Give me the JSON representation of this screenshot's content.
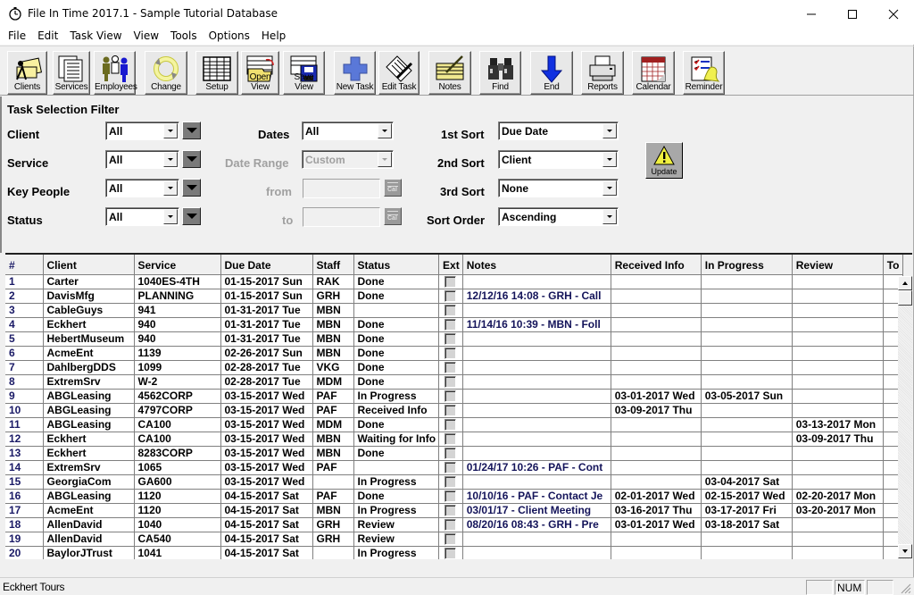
{
  "window": {
    "title": "File In Time 2017.1 - Sample Tutorial Database",
    "controls": {
      "minimize": "minimize",
      "maximize": "maximize",
      "close": "close"
    }
  },
  "menu": [
    "File",
    "Edit",
    "Task View",
    "View",
    "Tools",
    "Options",
    "Help"
  ],
  "toolbar": {
    "buttons": [
      {
        "id": "clients",
        "label": "Clients",
        "icon": "clients-icon"
      },
      {
        "id": "services",
        "label": "Services",
        "icon": "services-icon"
      },
      {
        "id": "employees",
        "label": "Employees",
        "icon": "employees-icon"
      },
      {
        "id": "change",
        "label": "Change",
        "icon": "change-icon"
      },
      {
        "id": "setup",
        "label": "Setup",
        "icon": "setup-icon"
      },
      {
        "id": "open-view",
        "label": "Open View",
        "icon": "open-view-icon"
      },
      {
        "id": "save-view",
        "label": "Save View",
        "icon": "save-view-icon"
      },
      {
        "id": "new-task",
        "label": "New Task",
        "icon": "plus-icon"
      },
      {
        "id": "edit-task",
        "label": "Edit Task",
        "icon": "edit-icon"
      },
      {
        "id": "notes",
        "label": "Notes",
        "icon": "notes-icon"
      },
      {
        "id": "find",
        "label": "Find",
        "icon": "binoculars-icon"
      },
      {
        "id": "end",
        "label": "End",
        "icon": "arrow-down-icon"
      },
      {
        "id": "reports",
        "label": "Reports",
        "icon": "printer-icon"
      },
      {
        "id": "calendar",
        "label": "Calendar",
        "icon": "calendar-icon"
      },
      {
        "id": "reminder",
        "label": "Reminder",
        "icon": "bell-icon"
      }
    ]
  },
  "filter": {
    "title": "Task Selection Filter",
    "client": {
      "label": "Client",
      "value": "All"
    },
    "service": {
      "label": "Service",
      "value": "All"
    },
    "key_people": {
      "label": "Key People",
      "value": "All"
    },
    "status": {
      "label": "Status",
      "value": "All"
    },
    "dates": {
      "label": "Dates",
      "value": "All"
    },
    "date_range": {
      "label": "Date Range",
      "value": "Custom"
    },
    "from": {
      "label": "from",
      "value": ""
    },
    "to": {
      "label": "to",
      "value": ""
    },
    "cal_label": "Cal",
    "sort1": {
      "label": "1st Sort",
      "value": "Due Date"
    },
    "sort2": {
      "label": "2nd Sort",
      "value": "Client"
    },
    "sort3": {
      "label": "3rd Sort",
      "value": "None"
    },
    "sort_order": {
      "label": "Sort Order",
      "value": "Ascending"
    },
    "update_label": "Update"
  },
  "grid": {
    "columns": [
      "#",
      "Client",
      "Service",
      "Due Date",
      "Staff",
      "Status",
      "Ext",
      "Notes",
      "Received Info",
      "In Progress",
      "Review",
      "To"
    ],
    "rows": [
      [
        "1",
        "Carter",
        "1040ES-4TH",
        "01-15-2017 Sun",
        "RAK",
        "Done",
        "",
        "",
        "",
        "",
        ""
      ],
      [
        "2",
        "DavisMfg",
        "PLANNING",
        "01-15-2017 Sun",
        "GRH",
        "Done",
        "",
        "12/12/16 14:08 - GRH - Call",
        "",
        "",
        ""
      ],
      [
        "3",
        "CableGuys",
        "941",
        "01-31-2017 Tue",
        "MBN",
        "",
        "",
        "",
        "",
        "",
        ""
      ],
      [
        "4",
        "Eckhert",
        "940",
        "01-31-2017 Tue",
        "MBN",
        "Done",
        "",
        "11/14/16 10:39 - MBN - Foll",
        "",
        "",
        ""
      ],
      [
        "5",
        "HebertMuseum",
        "940",
        "01-31-2017 Tue",
        "MBN",
        "Done",
        "",
        "",
        "",
        "",
        ""
      ],
      [
        "6",
        "AcmeEnt",
        "1139",
        "02-26-2017 Sun",
        "MBN",
        "Done",
        "",
        "",
        "",
        "",
        ""
      ],
      [
        "7",
        "DahlbergDDS",
        "1099",
        "02-28-2017 Tue",
        "VKG",
        "Done",
        "",
        "",
        "",
        "",
        ""
      ],
      [
        "8",
        "ExtremSrv",
        "W-2",
        "02-28-2017 Tue",
        "MDM",
        "Done",
        "",
        "",
        "",
        "",
        ""
      ],
      [
        "9",
        "ABGLeasing",
        "4562CORP",
        "03-15-2017 Wed",
        "PAF",
        "In Progress",
        "",
        "",
        "03-01-2017 Wed",
        "03-05-2017 Sun",
        ""
      ],
      [
        "10",
        "ABGLeasing",
        "4797CORP",
        "03-15-2017 Wed",
        "PAF",
        "Received Info",
        "",
        "",
        "03-09-2017 Thu",
        "",
        ""
      ],
      [
        "11",
        "ABGLeasing",
        "CA100",
        "03-15-2017 Wed",
        "MDM",
        "Done",
        "",
        "",
        "",
        "",
        "03-13-2017 Mon"
      ],
      [
        "12",
        "Eckhert",
        "CA100",
        "03-15-2017 Wed",
        "MBN",
        "Waiting for Info",
        "",
        "",
        "",
        "",
        "03-09-2017 Thu"
      ],
      [
        "13",
        "Eckhert",
        "8283CORP",
        "03-15-2017 Wed",
        "MBN",
        "Done",
        "",
        "",
        "",
        "",
        ""
      ],
      [
        "14",
        "ExtremSrv",
        "1065",
        "03-15-2017 Wed",
        "PAF",
        "",
        "",
        "01/24/17 10:26 - PAF - Cont",
        "",
        "",
        ""
      ],
      [
        "15",
        "GeorgiaCom",
        "GA600",
        "03-15-2017 Wed",
        "",
        "In Progress",
        "",
        "",
        "",
        "03-04-2017 Sat",
        ""
      ],
      [
        "16",
        "ABGLeasing",
        "1120",
        "04-15-2017 Sat",
        "PAF",
        "Done",
        "",
        "10/10/16 - PAF - Contact Je",
        "02-01-2017 Wed",
        "02-15-2017 Wed",
        "02-20-2017 Mon"
      ],
      [
        "17",
        "AcmeEnt",
        "1120",
        "04-15-2017 Sat",
        "MBN",
        "In Progress",
        "",
        "03/01/17 - Client Meeting",
        "03-16-2017 Thu",
        "03-17-2017 Fri",
        "03-20-2017 Mon"
      ],
      [
        "18",
        "AllenDavid",
        "1040",
        "04-15-2017 Sat",
        "GRH",
        "Review",
        "",
        "08/20/16 08:43 - GRH - Pre",
        "03-01-2017 Wed",
        "03-18-2017 Sat",
        ""
      ],
      [
        "19",
        "AllenDavid",
        "CA540",
        "04-15-2017 Sat",
        "GRH",
        "Review",
        "",
        "",
        "",
        "",
        ""
      ],
      [
        "20",
        "BaylorJTrust",
        "1041",
        "04-15-2017 Sat",
        "",
        "In Progress",
        "",
        "",
        "",
        "",
        ""
      ]
    ]
  },
  "statusbar": {
    "text": "Eckhert Tours",
    "num": "NUM"
  },
  "colors": {
    "number_text": "#1a1a66",
    "notes_text": "#14145a"
  }
}
